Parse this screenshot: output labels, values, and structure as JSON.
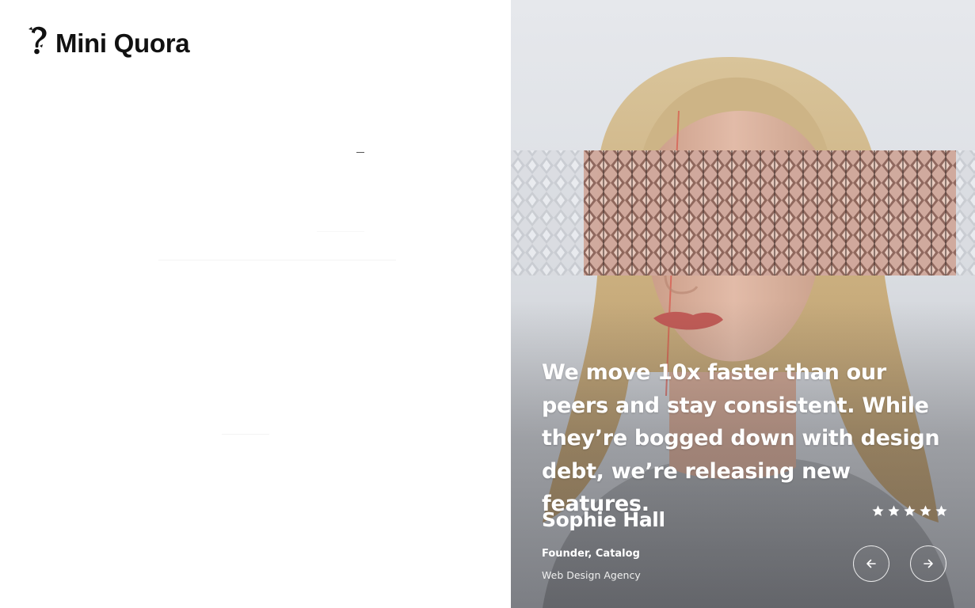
{
  "brand": {
    "name": "Mini Quora",
    "logo_icon": "question-mark-face-icon"
  },
  "testimonial": {
    "quote": "We move 10x faster than our peers and stay consistent. While they’re bogged down with design debt, we’re releasing new features.",
    "author_name": "Sophie Hall",
    "author_role": "Founder, Catalog",
    "author_company": "Web Design Agency",
    "rating": 5,
    "rating_max": 5,
    "prev_icon": "arrow-left-icon",
    "next_icon": "arrow-right-icon"
  },
  "colors": {
    "text_dark": "#111111",
    "text_light": "#ffffff"
  }
}
